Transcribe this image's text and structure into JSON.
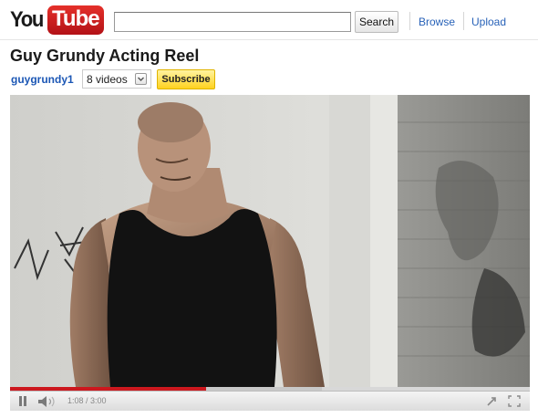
{
  "header": {
    "logo_you": "You",
    "logo_tube": "Tube",
    "search": {
      "value": "",
      "button_label": "Search"
    },
    "nav": {
      "browse_label": "Browse",
      "upload_label": "Upload"
    }
  },
  "video": {
    "title": "Guy Grundy Acting Reel",
    "channel": "guygrundy1",
    "videos_count_label": "8 videos",
    "subscribe_label": "Subscribe"
  },
  "player": {
    "time_label": "1:08 / 3:00",
    "played_fraction": 0.378,
    "loaded_fraction": 0.6,
    "state": "playing",
    "icons": [
      "pause-icon",
      "volume-icon",
      "popout-icon",
      "fullscreen-icon"
    ]
  },
  "colors": {
    "accent_red": "#cc181e",
    "link_blue": "#2862b8",
    "subscribe_yellow": "#ffd21f"
  }
}
